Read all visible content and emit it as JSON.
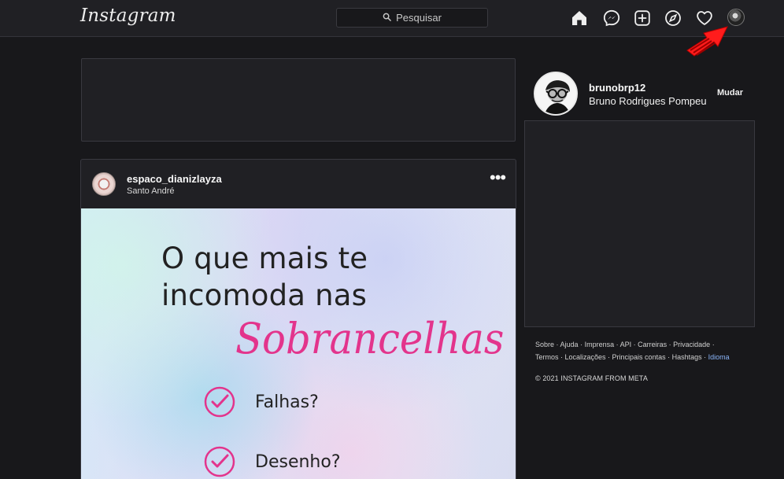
{
  "app": {
    "logo": "Instagram"
  },
  "search": {
    "placeholder": "Pesquisar",
    "icon": "search-icon"
  },
  "nav": {
    "icons": [
      "home-icon",
      "messenger-icon",
      "create-post-icon",
      "explore-icon",
      "activity-heart-icon",
      "profile-avatar-icon"
    ],
    "annotation": "red-pointer-arrow"
  },
  "post": {
    "username": "espaco_dianizlayza",
    "location": "Santo André",
    "more_icon": "more-options-icon",
    "image_text": {
      "line1": "O que mais te",
      "line2": "incomoda nas",
      "script": "Sobrancelhas",
      "items": [
        "Falhas?",
        "Desenho?"
      ]
    }
  },
  "profile": {
    "username": "brunobrp12",
    "full_name": "Bruno Rodrigues Pompeu",
    "switch_label": "Mudar"
  },
  "footer": {
    "links_line1": [
      "Sobre",
      "Ajuda",
      "Imprensa",
      "API",
      "Carreiras",
      "Privacidade"
    ],
    "links_line2": [
      "Termos",
      "Localizações",
      "Principais contas",
      "Hashtags",
      "Idioma"
    ],
    "copyright": "© 2021 INSTAGRAM FROM META"
  },
  "colors": {
    "background": "#18181b",
    "panel": "#202024",
    "accent_pink": "#e3348c",
    "link_blue": "#8ab4f8",
    "annotation_red": "#ff1c1c"
  }
}
